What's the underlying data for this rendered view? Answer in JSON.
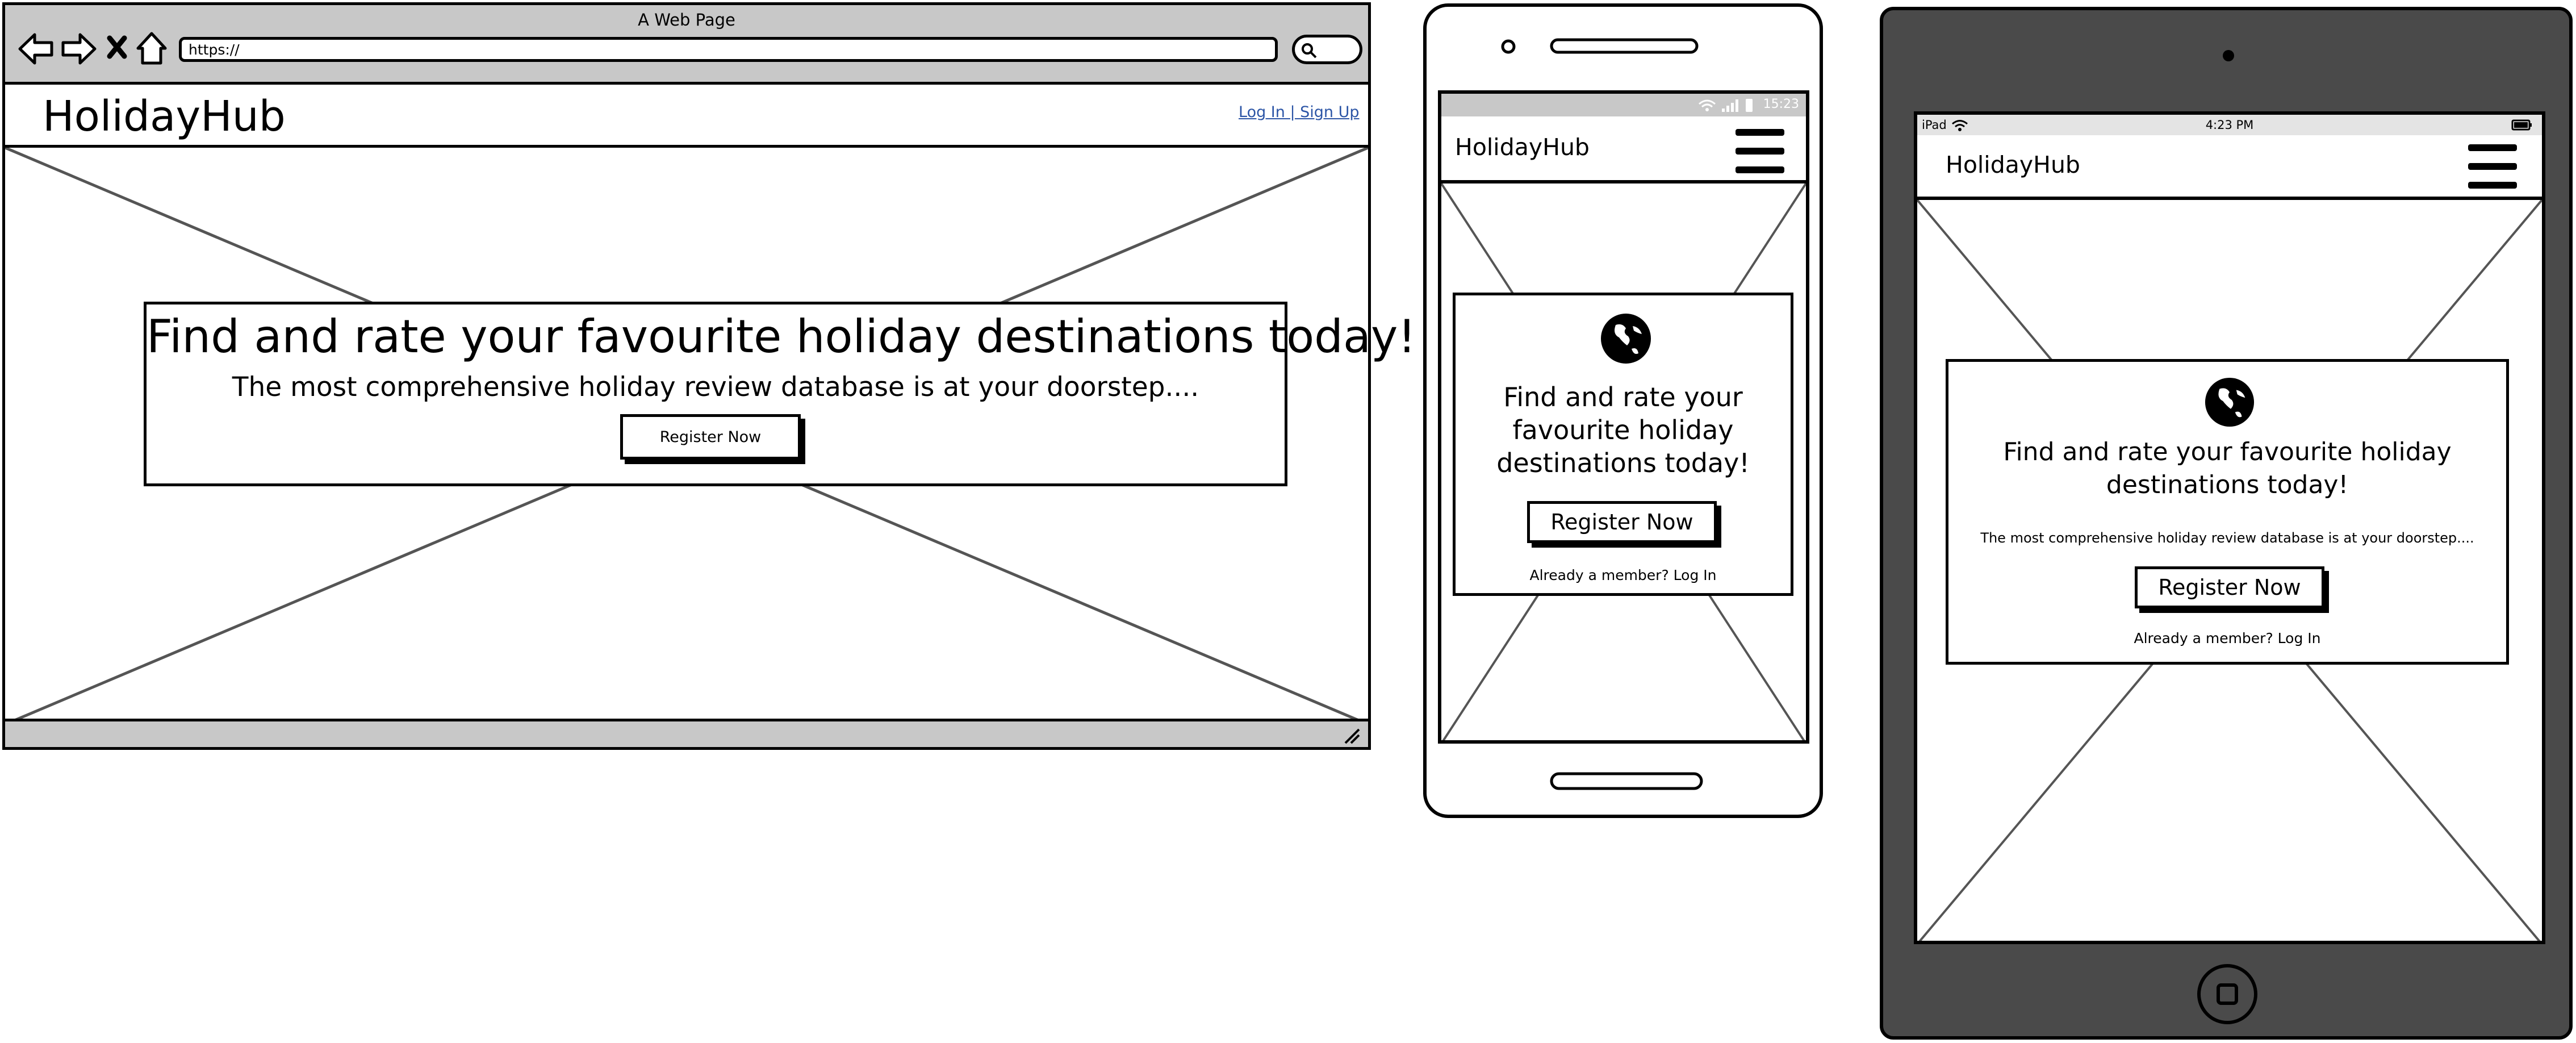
{
  "browser": {
    "window_title": "A Web Page",
    "url": "https://",
    "site_logo": "HolidayHub",
    "login_link": "Log In | Sign Up",
    "hero_heading": "Find and rate your favourite holiday destinations today!",
    "hero_subheading": "The most comprehensive holiday review database is at your doorstep....",
    "register_button": "Register Now"
  },
  "phone": {
    "status_time": "15:23",
    "site_logo": "HolidayHub",
    "hero_heading": "Find and rate your favourite holiday destinations today!",
    "register_button": "Register Now",
    "member_text": "Already a member? Log In"
  },
  "tablet": {
    "status_device": "iPad",
    "status_time": "4:23 PM",
    "site_logo": "HolidayHub",
    "hero_heading": "Find and rate your favourite holiday destinations today!",
    "hero_subheading": "The most comprehensive holiday review database is at your doorstep....",
    "register_button": "Register Now",
    "member_text": "Already a member? Log In"
  },
  "icons": [
    "back-arrow-icon",
    "forward-arrow-icon",
    "close-icon",
    "home-icon",
    "search-icon",
    "resize-grip-icon",
    "wifi-icon",
    "signal-icon",
    "battery-icon",
    "hamburger-menu-icon",
    "globe-icon",
    "home-button-icon"
  ],
  "colors": {
    "chrome_gray": "#c8c8c8",
    "tablet_body": "#4a4a4a",
    "link_blue": "#2c55a6"
  }
}
